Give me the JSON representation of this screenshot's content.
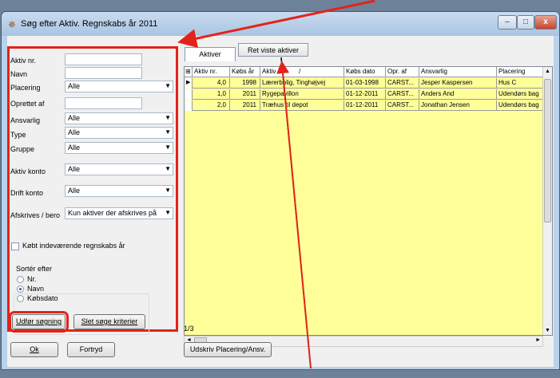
{
  "window": {
    "title": "Søg efter Aktiv. Regnskabs år 2011",
    "minimize_glyph": "–",
    "maximize_glyph": "□",
    "close_glyph": "x"
  },
  "filters": {
    "aktiv_nr_label": "Aktiv nr.",
    "aktiv_nr_value": "",
    "navn_label": "Navn",
    "navn_value": "",
    "placering_label": "Placering",
    "placering_value": "Alle",
    "oprettet_af_label": "Oprettet af",
    "oprettet_af_value": "",
    "ansvarlig_label": "Ansvarlig",
    "ansvarlig_value": "Alle",
    "type_label": "Type",
    "type_value": "Alle",
    "gruppe_label": "Gruppe",
    "gruppe_value": "Alle",
    "aktiv_konto_label": "Aktiv konto",
    "aktiv_konto_value": "Alle",
    "drift_konto_label": "Drift konto",
    "drift_konto_value": "Alle",
    "afskrives_label": "Afskrives / bero",
    "afskrives_value": "Kun aktiver der afskrives på",
    "kobt_label": "Købt indeværende regnskabs år",
    "sort_label": "Sortér efter",
    "sort_options": [
      "Nr.",
      "Navn",
      "Købsdato"
    ],
    "sort_selected": "Navn"
  },
  "buttons": {
    "search": "Udfør søgning",
    "clear": "Slet søge kriterier",
    "ok": "Ok",
    "cancel": "Fortryd",
    "print": "Udskriv Placering/Ansv."
  },
  "tabs": {
    "aktiver": "Aktiver",
    "ret": "Ret viste aktiver"
  },
  "grid": {
    "columns": [
      "Aktiv nr.",
      "Købs år",
      "Aktiv",
      "Købs dato",
      "Opr. af",
      "Ansvarlig",
      "Placering"
    ],
    "sort_marker": "/",
    "rows": [
      [
        "4,0",
        "1998",
        "Lærerbolig, Tinghøjvej",
        "01-03-1998",
        "CARST...",
        "Jesper Kaspersen",
        "Hus C"
      ],
      [
        "1,0",
        "2011",
        "Rygepavillon",
        "01-12-2011",
        "CARST...",
        "Anders And",
        "Udendørs bag"
      ],
      [
        "2,0",
        "2011",
        "Træhus til depot",
        "01-12-2011",
        "CARST...",
        "Jonathan Jensen",
        "Udendørs bag"
      ]
    ],
    "record_count": "1/3"
  },
  "colors": {
    "highlight": "#e2231a",
    "grid_bg": "#ffff99"
  }
}
